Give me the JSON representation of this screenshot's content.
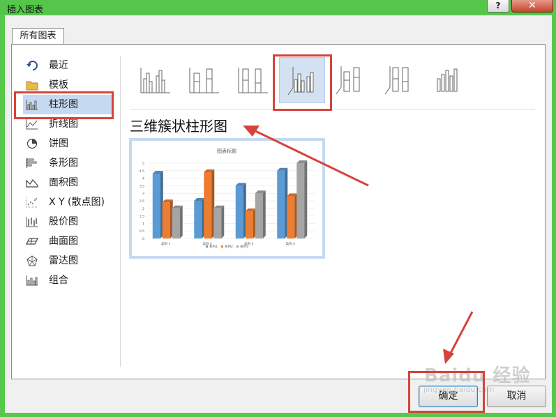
{
  "window": {
    "title": "插入图表",
    "help_label": "?",
    "close_label": "✕"
  },
  "tab": {
    "label": "所有图表"
  },
  "sidebar": {
    "items": [
      {
        "label": "最近",
        "icon": "recent-icon"
      },
      {
        "label": "模板",
        "icon": "folder-icon"
      },
      {
        "label": "柱形图",
        "icon": "column-chart-icon",
        "selected": true
      },
      {
        "label": "折线图",
        "icon": "line-chart-icon"
      },
      {
        "label": "饼图",
        "icon": "pie-chart-icon"
      },
      {
        "label": "条形图",
        "icon": "bar-chart-icon"
      },
      {
        "label": "面积图",
        "icon": "area-chart-icon"
      },
      {
        "label": "X Y (散点图)",
        "icon": "scatter-chart-icon"
      },
      {
        "label": "股价图",
        "icon": "stock-chart-icon"
      },
      {
        "label": "曲面图",
        "icon": "surface-chart-icon"
      },
      {
        "label": "雷达图",
        "icon": "radar-chart-icon"
      },
      {
        "label": "组合",
        "icon": "combo-chart-icon"
      }
    ]
  },
  "subtypes": [
    {
      "name": "clustered-column",
      "selected": false
    },
    {
      "name": "stacked-column",
      "selected": false
    },
    {
      "name": "100-stacked-column",
      "selected": false
    },
    {
      "name": "3d-clustered-column",
      "selected": true
    },
    {
      "name": "3d-stacked-column",
      "selected": false
    },
    {
      "name": "3d-100-stacked-column",
      "selected": false
    },
    {
      "name": "3d-column",
      "selected": false
    }
  ],
  "selected_type_label": "三维簇状柱形图",
  "chart_data": {
    "type": "bar",
    "title": "图表标题",
    "categories": [
      "类别 1",
      "类别 2",
      "类别 3",
      "类别 4"
    ],
    "series": [
      {
        "name": "系列1",
        "values": [
          4.3,
          2.5,
          3.5,
          4.5
        ],
        "color": "#5b9bd5"
      },
      {
        "name": "系列2",
        "values": [
          2.4,
          4.4,
          1.8,
          2.8
        ],
        "color": "#ed7d31"
      },
      {
        "name": "系列3",
        "values": [
          2,
          2,
          3,
          5
        ],
        "color": "#a5a5a5"
      }
    ],
    "y_ticks": [
      "0",
      "0.5",
      "1",
      "1.5",
      "2",
      "2.5",
      "3",
      "3.5",
      "4",
      "4.5",
      "5"
    ],
    "ylim": [
      0,
      5
    ],
    "legend": "bottom"
  },
  "buttons": {
    "ok_label": "确定",
    "cancel_label": "取消"
  },
  "colors": {
    "accent_selected": "#c5d9f1",
    "annotation_red": "#d6433b"
  },
  "watermark": {
    "main": "Baidu 经验",
    "sub": "jingyan.baidu.com"
  }
}
